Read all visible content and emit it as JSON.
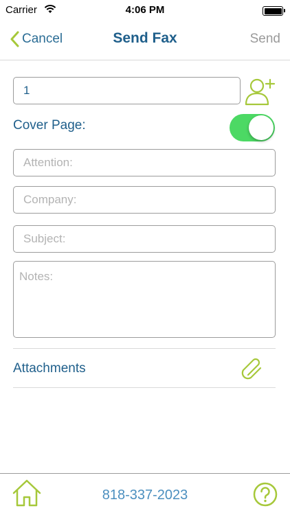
{
  "status_bar": {
    "carrier": "Carrier",
    "time": "4:06 PM"
  },
  "nav": {
    "back_label": "Cancel",
    "title": "Send Fax",
    "send_label": "Send"
  },
  "form": {
    "recipient_value": "1",
    "cover_page_label": "Cover Page:",
    "cover_page_on": true,
    "attention_placeholder": "Attention:",
    "company_placeholder": "Company:",
    "subject_placeholder": "Subject:",
    "notes_placeholder": "Notes:"
  },
  "attachments": {
    "label": "Attachments"
  },
  "tab_bar": {
    "phone": "818-337-2023"
  },
  "colors": {
    "accent_green": "#a6c83a",
    "title_blue": "#1f5f8b",
    "toggle_green": "#4cd964"
  }
}
